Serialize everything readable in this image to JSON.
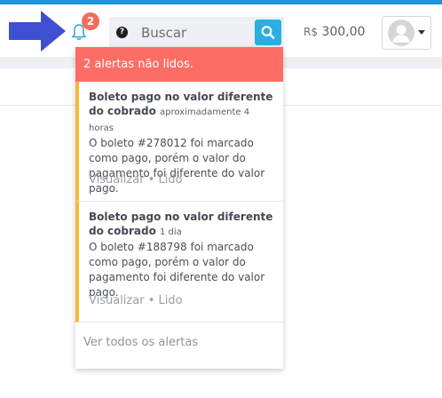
{
  "header": {
    "notification_count": "2",
    "search": {
      "placeholder": "Buscar"
    },
    "help_glyph": "?",
    "balance": {
      "currency": "R$",
      "amount": "300,00"
    },
    "user_menu": {
      "avatar_icon": "default-avatar-icon"
    }
  },
  "annotation": {
    "arrow_icon": "arrow-right-icon",
    "color": "#3f4fd1"
  },
  "dropdown": {
    "header_text": "2 alertas não lidos.",
    "alerts": [
      {
        "title": "Boleto pago no valor diferente do cobrado",
        "time": "aproximadamente 4 horas",
        "body": "O boleto #278012 foi marcado como pago, porém o valor do pagamento foi diferente do valor pago.",
        "view_label": "Visualizar",
        "separator": "•",
        "read_label": "Lido"
      },
      {
        "title": "Boleto pago no valor diferente do cobrado",
        "time": "1 dia",
        "body": "O boleto #188798 foi marcado como pago, porém o valor do pagamento foi diferente do valor pago.",
        "view_label": "Visualizar",
        "separator": "•",
        "read_label": "Lido"
      }
    ],
    "see_all_label": "Ver todos os alertas"
  },
  "colors": {
    "top_border": "#1e96dc",
    "badge": "#f26d5b",
    "dropdown_header": "#fc6e65",
    "alert_border": "#f9b934",
    "search_button": "#2daee0"
  }
}
